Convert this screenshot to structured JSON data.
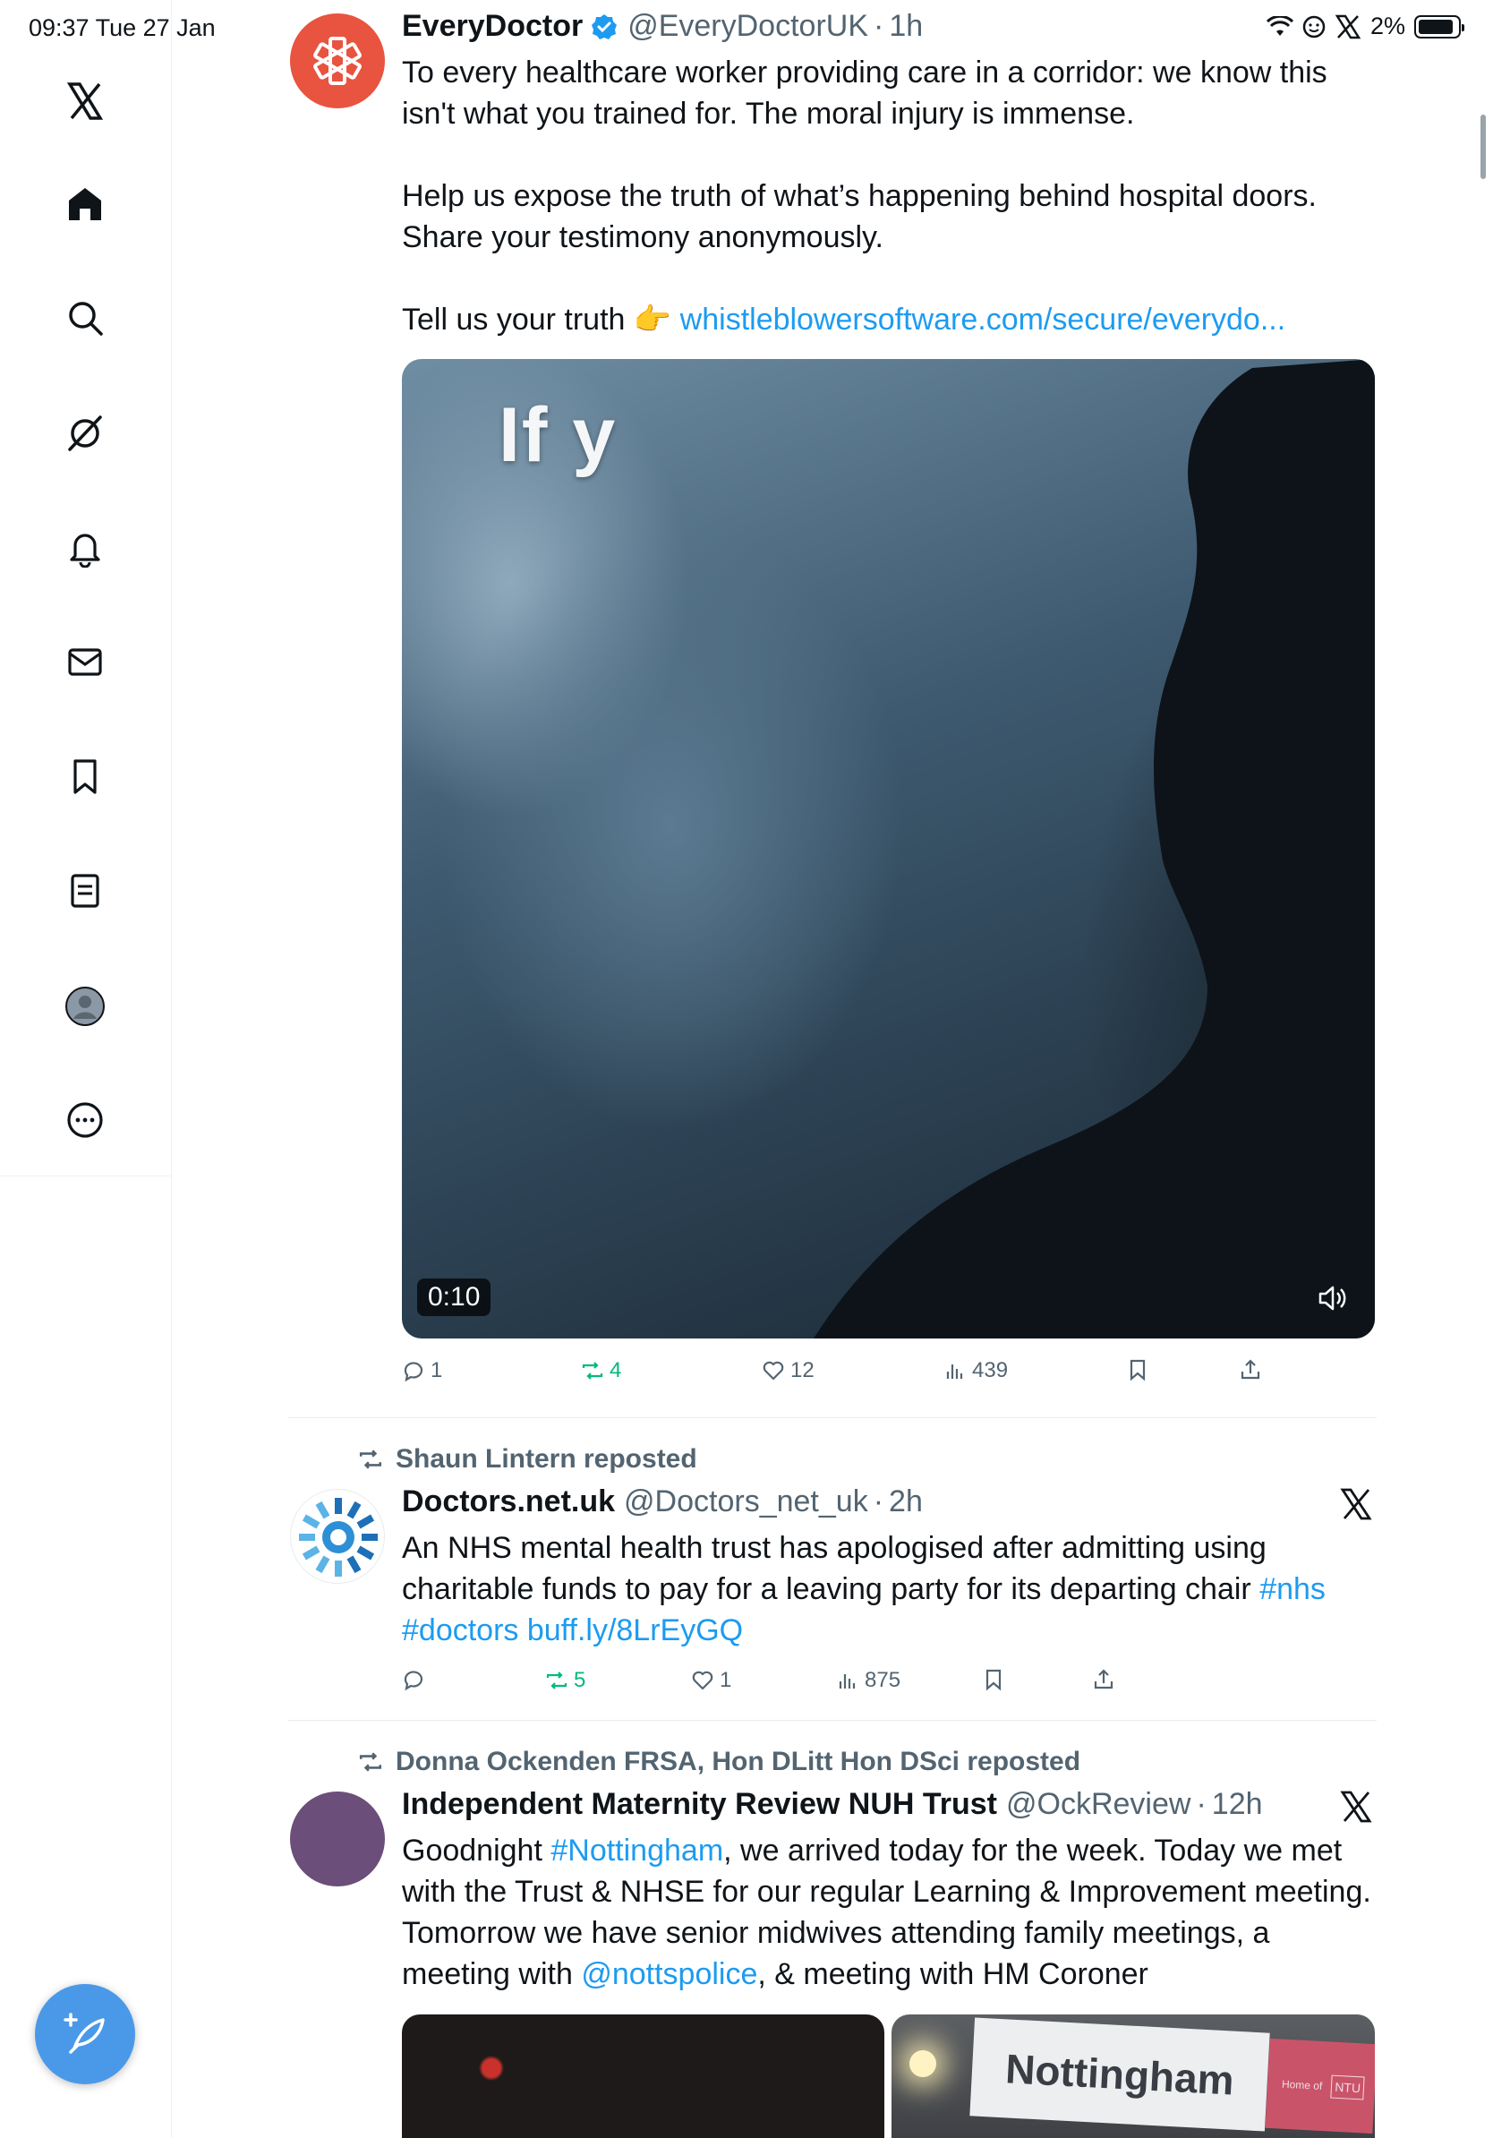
{
  "status_bar": {
    "time_date": "09:37  Tue 27 Jan",
    "battery": "2%",
    "battery_level": 0.9
  },
  "sidebar": {
    "items": [
      "X logo",
      "Home",
      "Search",
      "Grok",
      "Notifications",
      "Messages",
      "Bookmarks",
      "Lists",
      "Profile",
      "More"
    ],
    "compose_icon": "feather-plus-icon"
  },
  "posts": [
    {
      "name": "EveryDoctor",
      "verified": true,
      "handle": "@EveryDoctorUK",
      "time": "1h",
      "text": [
        "To every healthcare worker providing care in a corridor: we know this isn't what you trained for. The moral injury is immense.",
        "Help us expose the truth of what’s happening behind hospital doors. Share your testimony anonymously.",
        "Tell us your truth 👉"
      ],
      "link": "whistleblowersoftware.com/secure/everydo...",
      "video": {
        "overlay_text": "If y",
        "duration": "0:10"
      },
      "stats": {
        "replies": "1",
        "reposts": "4",
        "likes": "12",
        "views": "439"
      }
    },
    {
      "reposted_by": "Shaun Lintern reposted",
      "name": "Doctors.net.uk",
      "handle": "@Doctors_net_uk",
      "time": "2h",
      "text": "An NHS mental health trust has apologised after admitting using charitable funds to pay for a leaving party for its departing chair",
      "hashtag1": "#nhs",
      "hashtag2": "#doctors",
      "link": "buff.ly/8LrEyGQ",
      "stats": {
        "replies": "",
        "reposts": "5",
        "likes": "1",
        "views": "875"
      }
    },
    {
      "reposted_by": "Donna Ockenden FRSA, Hon DLitt Hon DSci reposted",
      "name": "Independent Maternity Review NUH Trust",
      "handle": "@OckReview",
      "time": "12h",
      "text_a": "Goodnight ",
      "hashtag": "#Nottingham",
      "text_b": ", we arrived today for the week. Today we met with the Trust & NHSE for our regular Learning & Improvement meeting. Tomorrow we have senior midwives attending family meetings, a meeting with ",
      "mention": "@nottspolice",
      "text_c": ", & meeting with HM Coroner",
      "image_sign": "Nottingham",
      "image_sign_small": "Home of",
      "image_sign_logo": "NTU"
    }
  ],
  "colors": {
    "accent": "#1d9bf0",
    "retweet_green": "#00ba7c",
    "muted": "#536471",
    "avatar_red": "#e8543f",
    "avatar_purple": "#6b4e79"
  }
}
